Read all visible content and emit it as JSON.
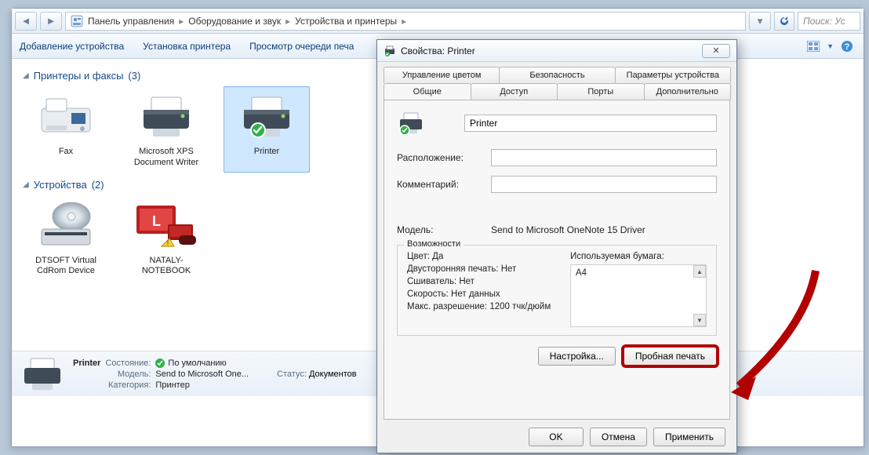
{
  "breadcrumb": {
    "c1": "Панель управления",
    "c2": "Оборудование и звук",
    "c3": "Устройства и принтеры"
  },
  "search_placeholder": "Поиск: Ус",
  "toolbar": {
    "add_device": "Добавление устройства",
    "add_printer": "Установка принтера",
    "view_queue": "Просмотр очереди печа"
  },
  "sections": {
    "printers": {
      "title": "Принтеры и факсы",
      "count": "(3)"
    },
    "devices": {
      "title": "Устройства",
      "count": "(2)"
    }
  },
  "items": {
    "fax": "Fax",
    "xps": "Microsoft XPS Document Writer",
    "printer": "Printer",
    "dtsoft": "DTSOFT Virtual CdRom Device",
    "nataly": "NATALY-NOTEBOOK"
  },
  "details": {
    "name": "Printer",
    "state_k": "Состояние:",
    "state_v": "По умолчанию",
    "status_k": "Статус:",
    "status_v": "Документов",
    "model_k": "Модель:",
    "model_v": "Send to Microsoft One...",
    "category_k": "Категория:",
    "category_v": "Принтер"
  },
  "dialog": {
    "title": "Свойства: Printer",
    "tabs_top": {
      "color": "Управление цветом",
      "security": "Безопасность",
      "devparams": "Параметры устройства"
    },
    "tabs_bot": {
      "general": "Общие",
      "access": "Доступ",
      "ports": "Порты",
      "advanced": "Дополнительно"
    },
    "name_value": "Printer",
    "location_label": "Расположение:",
    "comment_label": "Комментарий:",
    "model_label": "Модель:",
    "model_value": "Send to Microsoft OneNote 15 Driver",
    "caps": {
      "legend": "Возможности",
      "color": "Цвет: Да",
      "duplex": "Двусторонняя печать: Нет",
      "stapler": "Сшиватель: Нет",
      "speed": "Скорость: Нет данных",
      "maxres": "Макс. разрешение: 1200 тчк/дюйм",
      "paper_label": "Используемая бумага:",
      "paper_item": "A4"
    },
    "settings_btn": "Настройка...",
    "testprint_btn": "Пробная печать",
    "ok": "OK",
    "cancel": "Отмена",
    "apply": "Применить"
  }
}
